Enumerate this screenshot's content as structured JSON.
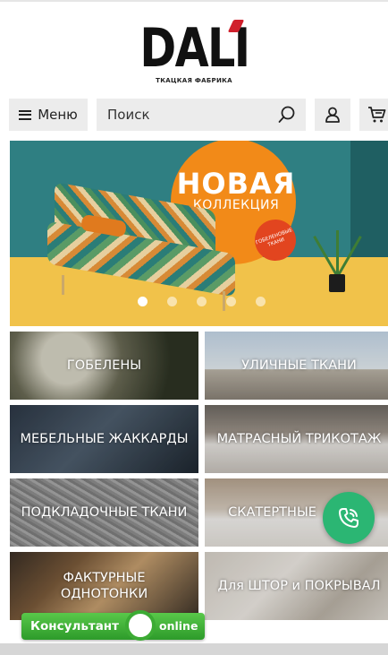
{
  "brand": {
    "name": "DALI",
    "tagline": "ТКАЦКАЯ ФАБРИКА",
    "accent_color": "#d0202c"
  },
  "nav": {
    "menu_label": "Меню",
    "menu_icon": "hamburger-icon",
    "search_placeholder": "Поиск",
    "search_icon": "search-icon",
    "user_icon": "user-icon",
    "cart_icon": "cart-icon"
  },
  "banner": {
    "title": "НОВАЯ",
    "subtitle": "КОЛЛЕКЦИЯ",
    "badge": "ГОБЕЛЕНОВЫЕ ТКАНИ",
    "slides": 5,
    "active_slide": 1
  },
  "categories": [
    {
      "label": "ГОБЕЛЕНЫ"
    },
    {
      "label": "УЛИЧНЫЕ ТКАНИ"
    },
    {
      "label": "МЕБЕЛЬНЫЕ ЖАККАРДЫ"
    },
    {
      "label": "МАТРАСНЫЙ ТРИКОТАЖ"
    },
    {
      "label": "ПОДКЛАДОЧНЫЕ ТКАНИ"
    },
    {
      "label": "СКАТЕРТНЫЕ"
    },
    {
      "label": "ФАКТУРНЫЕ ОДНОТОНКИ"
    },
    {
      "label": "Для ШТОР и ПОКРЫВАЛ"
    }
  ],
  "widgets": {
    "consultant_label": "Консультант",
    "consultant_status": "online",
    "call_icon": "phone-icon",
    "call_color": "#2bb673"
  }
}
